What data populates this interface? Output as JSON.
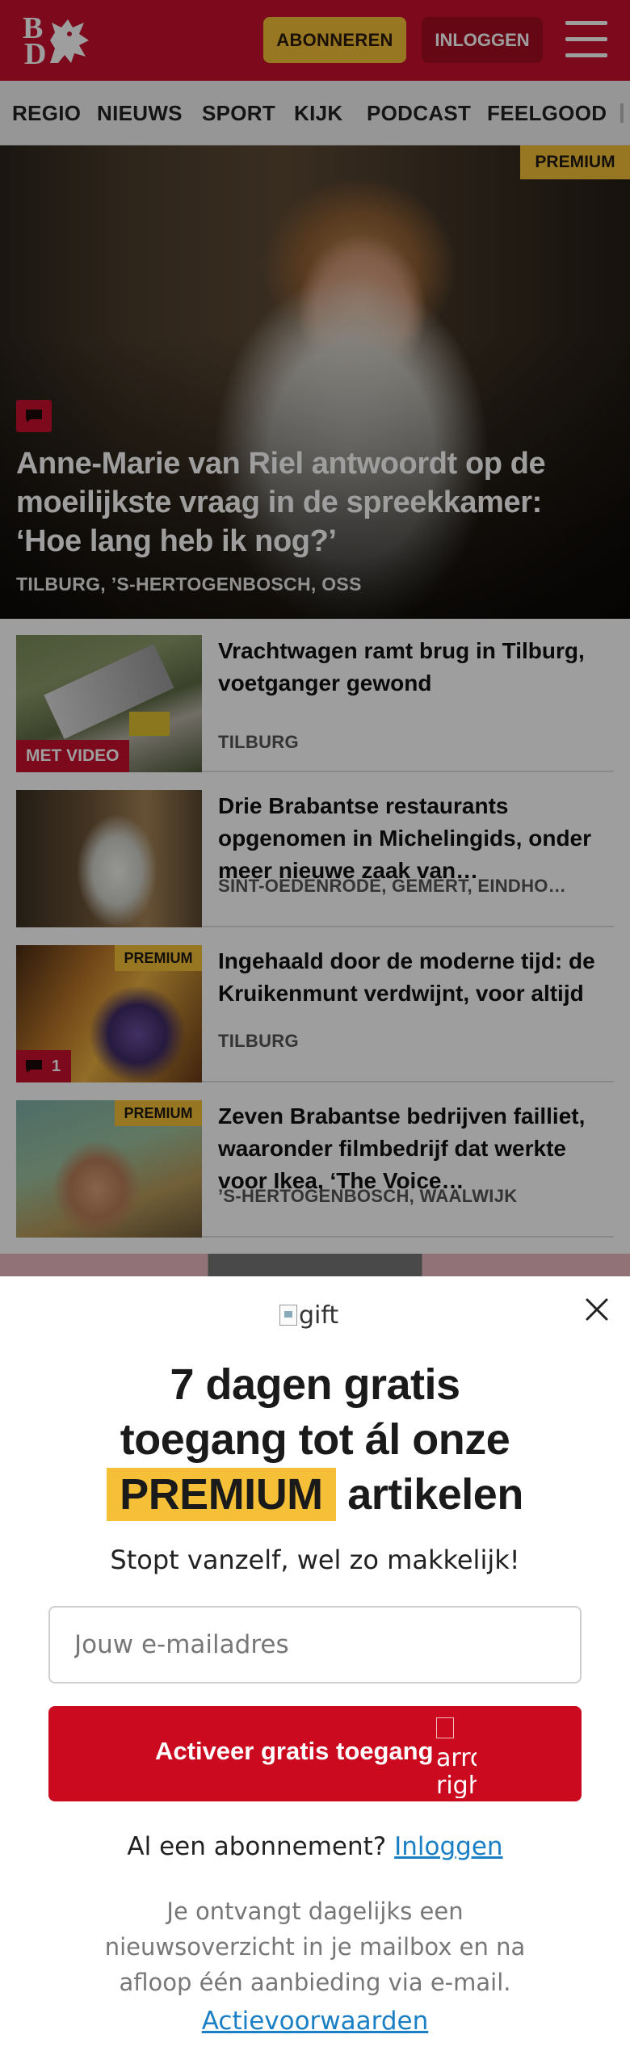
{
  "header": {
    "logo_letters": [
      "B",
      "D"
    ],
    "subscribe_label": "ABONNEREN",
    "login_label": "INLOGGEN",
    "menu_icon": "hamburger-menu-icon"
  },
  "nav": {
    "items": [
      "REGIO",
      "NIEUWS",
      "SPORT",
      "KIJK",
      "PODCAST",
      "FEELGOOD"
    ]
  },
  "hero": {
    "badge": "PREMIUM",
    "comment_icon": "comment-icon",
    "title": "Anne-Marie van Riel antwoordt op de moeilijkste vraag in de spreekkamer: ‘Hoe lang heb ik nog?’",
    "location": "TILBURG, ’S-HERTOGENBOSCH, OSS"
  },
  "articles": [
    {
      "title": "Vrachtwagen ramt brug in Tilburg, voetganger gewond",
      "location": "TILBURG",
      "badge_video": "MET VIDEO"
    },
    {
      "title": "Drie Brabantse restaurants opgenomen in Michelingids, onder meer nieuwe zaak van…",
      "location": "SINT-OEDENRODE, GEMERT, EINDHO…"
    },
    {
      "title": "Ingehaald door de moderne tijd: de Kruikenmunt verdwijnt, voor altijd",
      "location": "TILBURG",
      "badge_premium": "PREMIUM",
      "comment_count": "1"
    },
    {
      "title": "Zeven Brabantse bedrijven failliet, waaronder filmbedrijf dat werkte voor Ikea, ‘The Voice…",
      "location": "’S-HERTOGENBOSCH, WAALWIJK",
      "badge_premium": "PREMIUM"
    }
  ],
  "modal": {
    "gift_alt": "gift",
    "headline_line1": "7 dagen gratis",
    "headline_line2": "toegang tot ál onze",
    "headline_premium": "PREMIUM",
    "headline_line3_rest": "artikelen",
    "subline": "Stopt vanzelf, wel zo makkelijk!",
    "email_placeholder": "Jouw e-mailadres",
    "cta_label": "Activeer gratis toegang",
    "cta_arrow_alt": "arrow right",
    "login_prompt": "Al een abonnement?",
    "login_link": "Inloggen",
    "info": "Je ontvangt dagelijks een nieuwsoverzicht in je mailbox en na afloop één aanbieding via e-mail.",
    "terms": "Actievoorwaarden",
    "close_icon": "close-icon"
  },
  "colors": {
    "brand_red": "#c8102e",
    "premium_yellow": "#f5c038",
    "link_blue": "#1a7fc4"
  }
}
